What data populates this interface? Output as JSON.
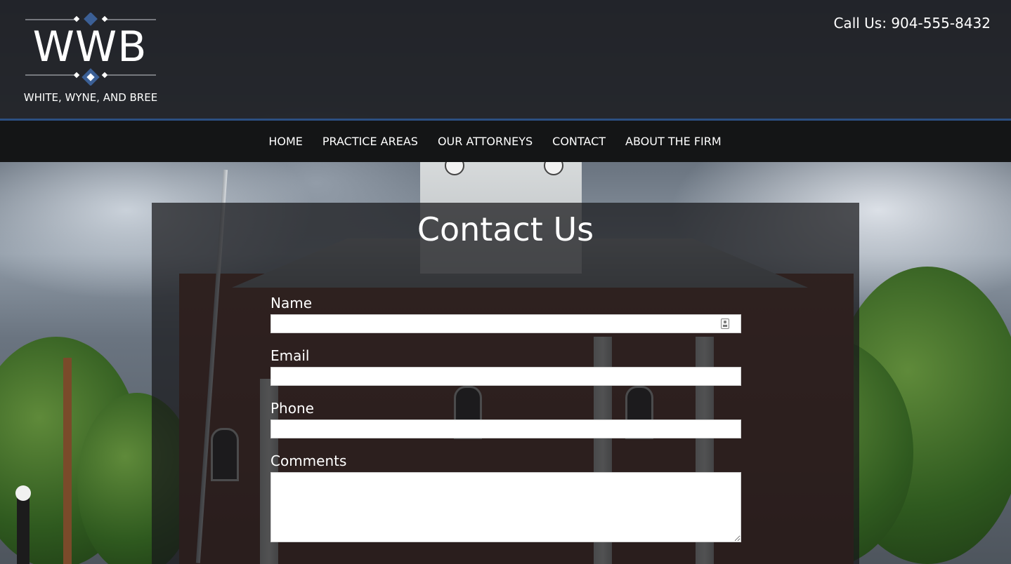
{
  "header": {
    "logo_letters": "WWB",
    "firm_name": "WHITE, WYNE, AND BREE",
    "phone": "Call Us: 904-555-8432"
  },
  "nav": {
    "items": [
      {
        "label": "HOME"
      },
      {
        "label": "PRACTICE AREAS"
      },
      {
        "label": "OUR ATTORNEYS"
      },
      {
        "label": "CONTACT"
      },
      {
        "label": "ABOUT THE FIRM"
      }
    ]
  },
  "contact_form": {
    "title": "Contact Us",
    "name_label": "Name",
    "name_value": "",
    "email_label": "Email",
    "email_value": "",
    "phone_label": "Phone",
    "phone_value": "",
    "comments_label": "Comments",
    "comments_value": ""
  },
  "colors": {
    "accent": "#2c4f82",
    "header_bg": "#1c1e22",
    "nav_bg": "#141516"
  },
  "icons": {
    "autofill": "contact-card-icon",
    "logo_diamond": "diamond-icon"
  }
}
